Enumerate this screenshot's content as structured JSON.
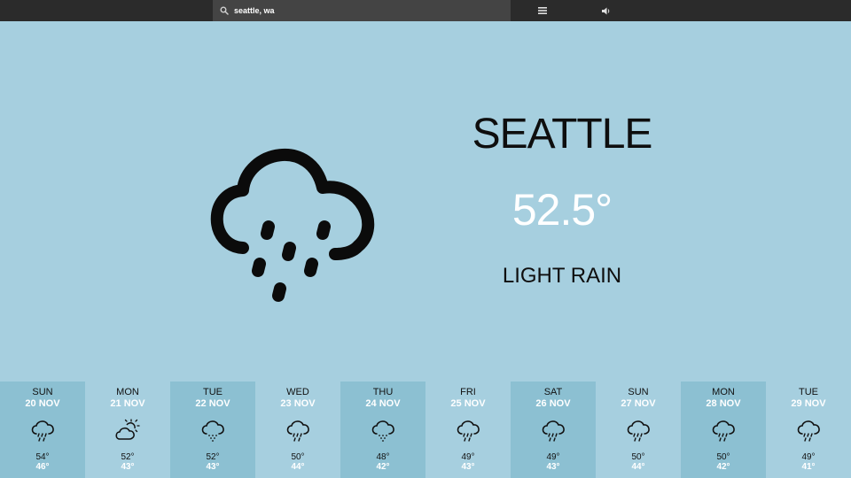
{
  "search": {
    "value": "seattle, wa",
    "icon": "search-icon"
  },
  "toolbar": {
    "menu_icon": "menu-icon",
    "sound_icon": "speaker-icon"
  },
  "current": {
    "city": "SEATTLE",
    "temperature": "52.5°",
    "condition": "LIGHT RAIN",
    "icon": "cloud-rain-icon"
  },
  "colors": {
    "background": "#a6cfdf",
    "shaded_day": "#8cc0d2",
    "topbar": "#2b2b2b"
  },
  "forecast": [
    {
      "day": "SUN",
      "date": "20 NOV",
      "high": "54°",
      "low": "46°",
      "icon": "cloud-rain-icon"
    },
    {
      "day": "MON",
      "date": "21 NOV",
      "high": "52°",
      "low": "43°",
      "icon": "partly-cloudy-icon"
    },
    {
      "day": "TUE",
      "date": "22 NOV",
      "high": "52°",
      "low": "43°",
      "icon": "cloud-drizzle-icon"
    },
    {
      "day": "WED",
      "date": "23 NOV",
      "high": "50°",
      "low": "44°",
      "icon": "cloud-rain-icon"
    },
    {
      "day": "THU",
      "date": "24 NOV",
      "high": "48°",
      "low": "42°",
      "icon": "cloud-drizzle-icon"
    },
    {
      "day": "FRI",
      "date": "25 NOV",
      "high": "49°",
      "low": "43°",
      "icon": "cloud-rain-icon"
    },
    {
      "day": "SAT",
      "date": "26 NOV",
      "high": "49°",
      "low": "43°",
      "icon": "cloud-rain-icon"
    },
    {
      "day": "SUN",
      "date": "27 NOV",
      "high": "50°",
      "low": "44°",
      "icon": "cloud-rain-icon"
    },
    {
      "day": "MON",
      "date": "28 NOV",
      "high": "50°",
      "low": "42°",
      "icon": "cloud-rain-icon"
    },
    {
      "day": "TUE",
      "date": "29 NOV",
      "high": "49°",
      "low": "41°",
      "icon": "cloud-rain-icon"
    }
  ]
}
